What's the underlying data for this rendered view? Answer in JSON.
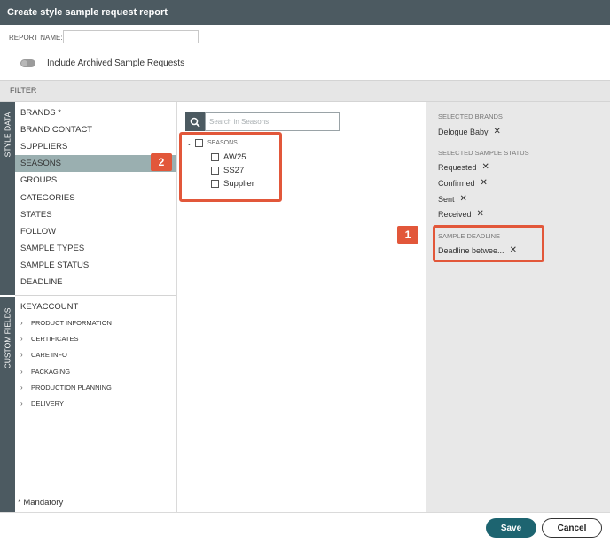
{
  "dialog": {
    "title": "Create style sample request report"
  },
  "report_name": {
    "label": "REPORT NAME:",
    "value": "",
    "placeholder": ""
  },
  "archived_toggle": {
    "label": "Include Archived Sample Requests",
    "on": false
  },
  "filter": {
    "label": "FILTER"
  },
  "side_tabs": {
    "style_data": "STYLE DATA",
    "custom_fields": "CUSTOM FIELDS"
  },
  "style_data_items": [
    "BRANDS *",
    "BRAND CONTACT",
    "SUPPLIERS",
    "SEASONS",
    "GROUPS",
    "CATEGORIES",
    "STATES",
    "FOLLOW",
    "SAMPLE TYPES",
    "SAMPLE STATUS",
    "DEADLINE"
  ],
  "custom_fields": {
    "keyaccount": "KEYACCOUNT",
    "groups": [
      "PRODUCT INFORMATION",
      "CERTIFICATES",
      "CARE INFO",
      "PACKAGING",
      "PRODUCTION PLANNING",
      "DELIVERY"
    ]
  },
  "mandatory_note": "* Mandatory",
  "search": {
    "placeholder": "Search in Seasons",
    "value": ""
  },
  "seasons_tree": {
    "root": "SEASONS",
    "items": [
      "AW25",
      "SS27",
      "Supplier"
    ]
  },
  "selected": {
    "brands_heading": "SELECTED BRANDS",
    "brands": [
      "Delogue Baby"
    ],
    "status_heading": "SELECTED SAMPLE STATUS",
    "statuses": [
      "Requested",
      "Confirmed",
      "Sent",
      "Received"
    ],
    "deadline_heading": "SAMPLE DEADLINE",
    "deadline_value": "Deadline betwee...",
    "remove_glyph": "✕"
  },
  "callouts": {
    "one": "1",
    "two": "2"
  },
  "footer": {
    "save": "Save",
    "cancel": "Cancel"
  },
  "colors": {
    "header": "#4c5a61",
    "active_item": "#9aafb0",
    "accent": "#e2573a",
    "primary_button": "#1d6470"
  }
}
